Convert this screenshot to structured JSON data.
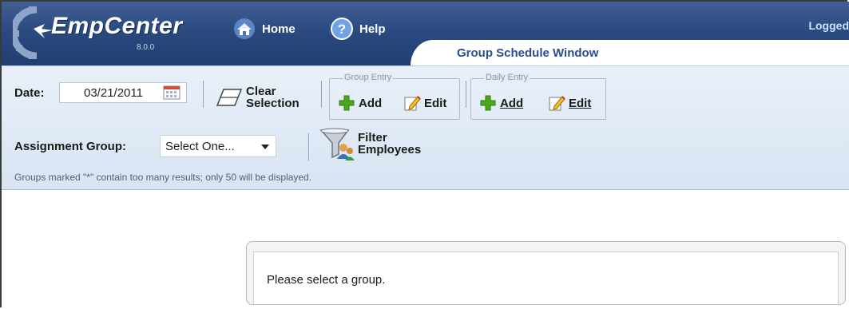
{
  "header": {
    "app_name": "EmpCenter",
    "version": "8.0.0",
    "nav": {
      "home": "Home",
      "help": "Help"
    },
    "logged_in_text": "Logged",
    "window_title": "Group Schedule Window"
  },
  "toolbar": {
    "date_label": "Date:",
    "date_value": "03/21/2011",
    "clear_selection_line1": "Clear",
    "clear_selection_line2": "Selection",
    "group_entry": {
      "legend": "Group Entry",
      "add": "Add",
      "edit": "Edit"
    },
    "daily_entry": {
      "legend": "Daily Entry",
      "add": "Add",
      "edit": "Edit"
    },
    "assignment_group_label": "Assignment Group:",
    "assignment_group_value": "Select One...",
    "filter_line1": "Filter",
    "filter_line2": "Employees",
    "note": "Groups marked \"*\" contain too many results; only 50 will be displayed."
  },
  "message": {
    "text": "Please select a group."
  },
  "colors": {
    "header_blue": "#2a4a80",
    "toolbar_bg": "#dfe8f5",
    "title_text": "#2a4f8f",
    "add_green": "#4aa820"
  }
}
